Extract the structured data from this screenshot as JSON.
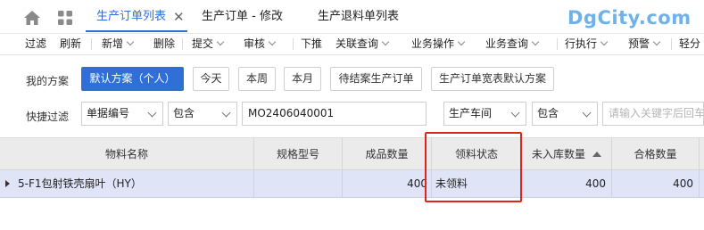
{
  "tabs": [
    {
      "label": "生产订单列表",
      "active": true
    },
    {
      "label": "生产订单 - 修改",
      "active": false
    },
    {
      "label": "生产退料单列表",
      "active": false
    }
  ],
  "icons": {
    "home": "home-icon",
    "apps": "grid-icon",
    "close": "close-icon"
  },
  "watermark": "DgCity.com",
  "toolbar": {
    "filter": "过滤",
    "refresh": "刷新",
    "add": "新增",
    "delete": "删除",
    "submit": "提交",
    "audit": "审核",
    "push_down": "下推",
    "related_query": "关联查询",
    "business_op": "业务操作",
    "business_query": "业务查询",
    "execute": "行执行",
    "warning": "预警",
    "light_analysis": "轻分"
  },
  "filter": {
    "scheme_label": "我的方案",
    "schemes": [
      "默认方案（个人）",
      "今天",
      "本周",
      "本月",
      "待结案生产订单",
      "生产订单宽表默认方案"
    ],
    "quick_label": "快捷过滤",
    "field1": "单据编号",
    "op1": "包含",
    "value1": "MO2406040001",
    "field2": "生产车间",
    "op2": "包含",
    "value2_placeholder": "请输入关键字后回车"
  },
  "grid": {
    "columns": [
      "物料名称",
      "规格型号",
      "成品数量",
      "领料状态",
      "未入库数量",
      "合格数量"
    ],
    "rows": [
      {
        "material": "5-F1包射铁壳扇叶（HY）",
        "spec": "",
        "qty": "400",
        "pick_status": "未领料",
        "not_stored": "400",
        "qualified": "400"
      }
    ]
  },
  "colors": {
    "accent": "#2f6fd6",
    "highlight": "#e0241b",
    "row_selected": "#dfe5f7"
  }
}
